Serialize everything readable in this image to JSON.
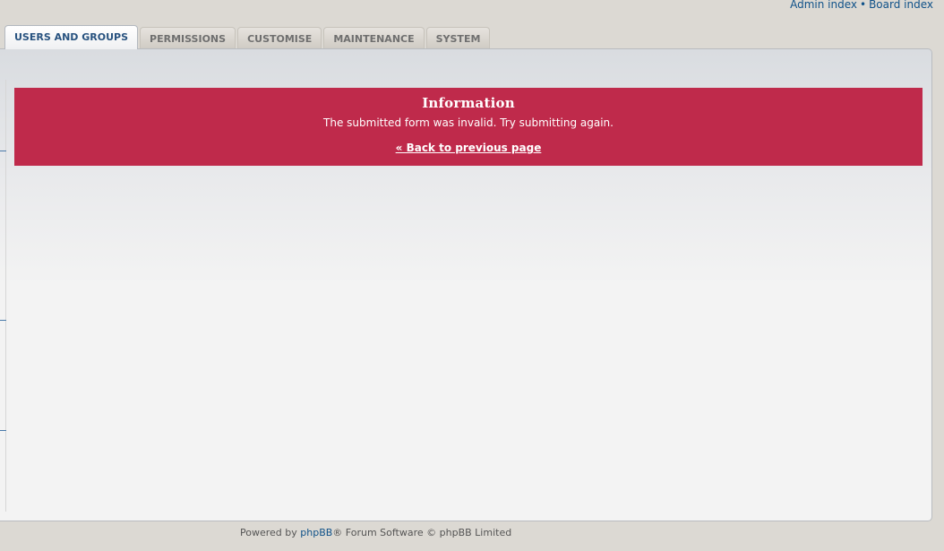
{
  "header": {
    "links": [
      {
        "label": "Admin index"
      },
      {
        "label": "Board index"
      }
    ],
    "separator": "•"
  },
  "tabs": [
    {
      "label": "USERS AND GROUPS",
      "active": true
    },
    {
      "label": "PERMISSIONS",
      "active": false
    },
    {
      "label": "CUSTOMISE",
      "active": false
    },
    {
      "label": "MAINTENANCE",
      "active": false
    },
    {
      "label": "SYSTEM",
      "active": false
    }
  ],
  "message": {
    "title": "Information",
    "text": "The submitted form was invalid. Try submitting again.",
    "back_link": "« Back to previous page",
    "background_color": "#bf2a4b"
  },
  "footer": {
    "prefix": "Powered by ",
    "brand": "phpBB",
    "suffix": "® Forum Software © phpBB Limited"
  },
  "colors": {
    "link": "#105289",
    "active_tab_text": "#28527f",
    "page_background": "#dcd9d3"
  }
}
